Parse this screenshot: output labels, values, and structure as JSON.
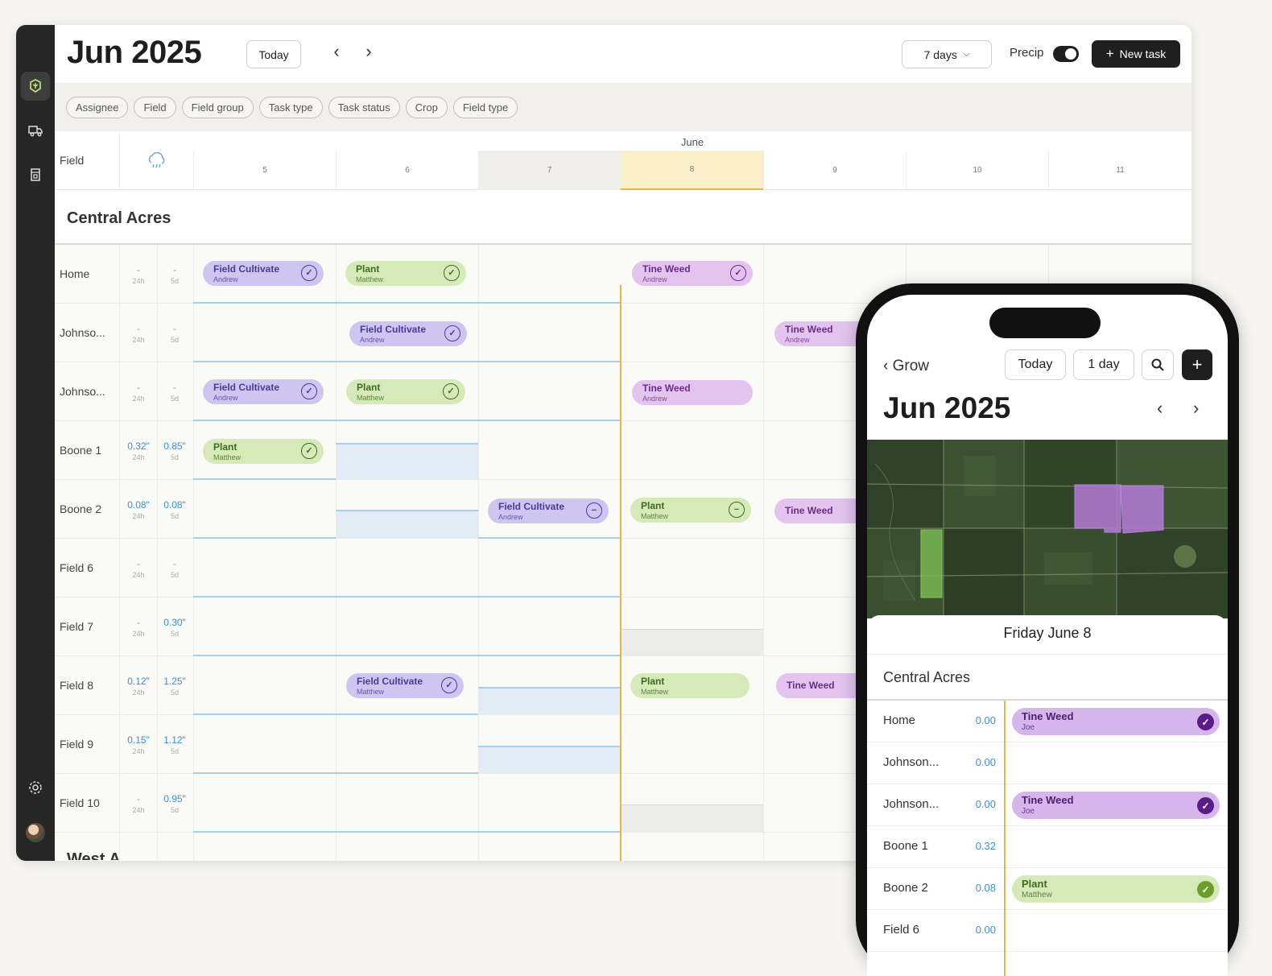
{
  "desktop": {
    "title": "Jun 2025",
    "today_label": "Today",
    "prev_icon": "‹",
    "next_icon": "›",
    "range_select": "7 days",
    "precip_label": "Precip",
    "new_task_label": "New task",
    "filters": [
      "Assignee",
      "Field",
      "Field group",
      "Task type",
      "Task status",
      "Crop",
      "Field type"
    ],
    "field_col_label": "Field",
    "month_label": "June",
    "days": [
      "5",
      "6",
      "7",
      "8",
      "9",
      "10",
      "11"
    ],
    "group_name": "Central Acres",
    "fields": [
      {
        "name": "Home",
        "p24": "-",
        "p5d": "-"
      },
      {
        "name": "Johnso...",
        "p24": "-",
        "p5d": "-"
      },
      {
        "name": "Johnso...",
        "p24": "-",
        "p5d": "-"
      },
      {
        "name": "Boone 1",
        "p24": "0.32\"",
        "p5d": "0.85\""
      },
      {
        "name": "Boone 2",
        "p24": "0.08\"",
        "p5d": "0.08\""
      },
      {
        "name": "Field 6",
        "p24": "-",
        "p5d": "-"
      },
      {
        "name": "Field 7",
        "p24": "-",
        "p5d": "0.30\""
      },
      {
        "name": "Field 8",
        "p24": "0.12\"",
        "p5d": "1.25\""
      },
      {
        "name": "Field 9",
        "p24": "0.15\"",
        "p5d": "1.12\""
      },
      {
        "name": "Field 10",
        "p24": "-",
        "p5d": "0.95\""
      }
    ],
    "unit_24h": "24h",
    "unit_5d": "5d",
    "tasks": [
      {
        "label": "Field Cultivate",
        "who": "Andrew"
      },
      {
        "label": "Plant",
        "who": "Matthew"
      },
      {
        "label": "Tine Weed",
        "who": "Andrew"
      },
      {
        "label": "Field Cultivate",
        "who": "Andrew"
      },
      {
        "label": "Tine Weed",
        "who": "Andrew"
      },
      {
        "label": "Field Cultivate",
        "who": "Andrew"
      },
      {
        "label": "Plant",
        "who": "Matthew"
      },
      {
        "label": "Tine Weed",
        "who": "Andrew"
      },
      {
        "label": "Plant",
        "who": "Matthew"
      },
      {
        "label": "Field Cultivate",
        "who": "Andrew"
      },
      {
        "label": "Plant",
        "who": "Matthew"
      },
      {
        "label": "Tine Weed",
        "who": ""
      },
      {
        "label": "Field Cultivate",
        "who": "Matthew"
      },
      {
        "label": "Plant",
        "who": "Matthew"
      },
      {
        "label": "Tine Weed",
        "who": ""
      }
    ],
    "next_group_partial": "West A"
  },
  "phone": {
    "back_label": "Grow",
    "today_label": "Today",
    "range_label": "1 day",
    "title": "Jun 2025",
    "date_label": "Friday June 8",
    "group_name": "Central Acres",
    "rows": [
      {
        "name": "Home",
        "value": "0.00"
      },
      {
        "name": "Johnson...",
        "value": "0.00"
      },
      {
        "name": "Johnson...",
        "value": "0.00"
      },
      {
        "name": "Boone 1",
        "value": "0.32"
      },
      {
        "name": "Boone 2",
        "value": "0.08"
      },
      {
        "name": "Field 6",
        "value": "0.00"
      }
    ],
    "tasks": [
      {
        "label": "Tine Weed",
        "who": "Joe"
      },
      {
        "label": "Tine Weed",
        "who": "Joe"
      },
      {
        "label": "Plant",
        "who": "Matthew"
      }
    ]
  },
  "colors": {
    "accent_dark": "#1f1f1f",
    "today_highlight": "#faefc8",
    "today_line": "#e8b24e",
    "precip_blue": "#3d8fd6",
    "task_purple": "#cfc5f1",
    "task_green": "#d6eab9",
    "task_pink": "#e2c4ef"
  }
}
